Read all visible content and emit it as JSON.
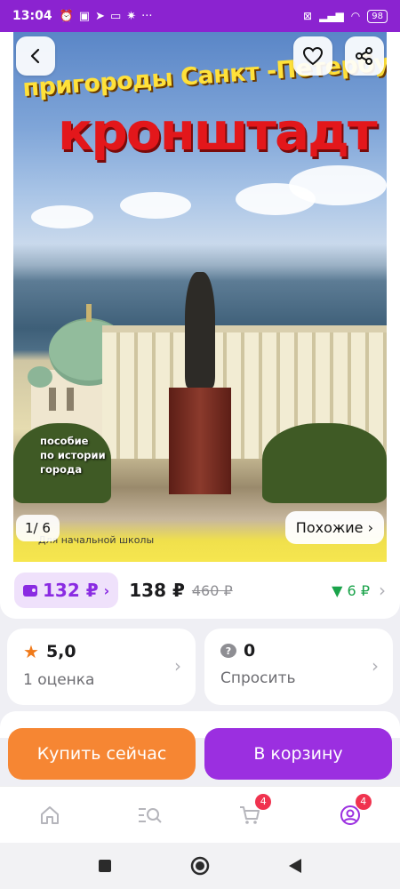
{
  "status_bar": {
    "time": "13:04",
    "battery": "98",
    "icons_left": [
      "alarm-icon",
      "n-icon",
      "telegram-icon",
      "mail-icon",
      "spark-icon",
      "more-icon"
    ],
    "icons_right": [
      "mute-icon",
      "signal-icon",
      "wifi-icon",
      "battery-icon"
    ]
  },
  "gallery": {
    "counter": "1/ 6",
    "similar_label": "Похожие ›",
    "cover": {
      "subtitle": "пригороды Санкт -Петербурга",
      "title": "кронштадт",
      "note_lines": [
        "пособие",
        "по истории",
        "города"
      ],
      "strip_text": "Для  начальной  школы"
    }
  },
  "price": {
    "wallet_price": "132 ₽",
    "price": "138 ₽",
    "old_price": "460 ₽",
    "bonus": "▼ 6 ₽",
    "colors": {
      "wallet": "#8a2be2",
      "bonus": "#1aa34a"
    }
  },
  "rating": {
    "value": "5,0",
    "count_label": "1 оценка"
  },
  "questions": {
    "count": "0",
    "label": "Спросить"
  },
  "actions": {
    "buy_label": "Купить сейчас",
    "cart_label": "В корзину",
    "colors": {
      "buy": "#f68633",
      "cart": "#9b2fe0"
    }
  },
  "bottom_nav": {
    "cart_badge": "4",
    "profile_badge": "4"
  }
}
